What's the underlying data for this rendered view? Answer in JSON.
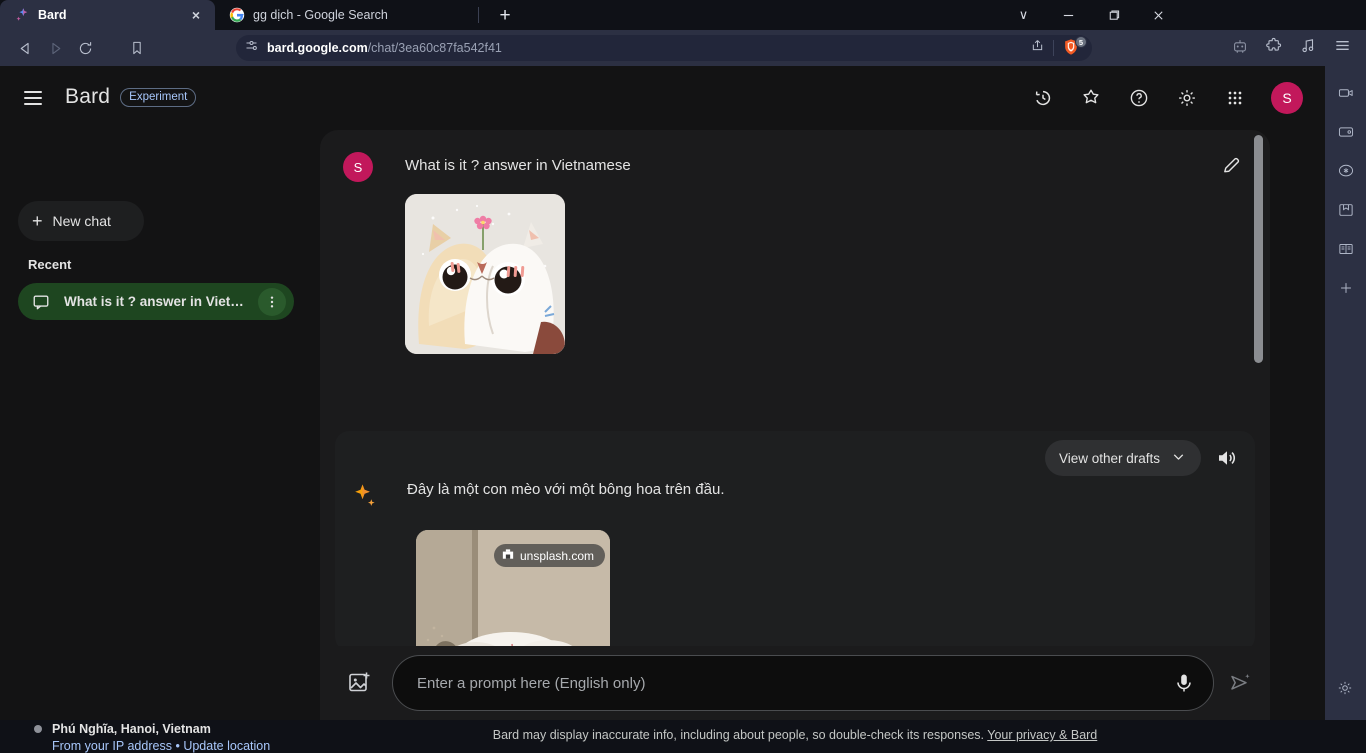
{
  "browser": {
    "name": "Brave",
    "tabs": [
      {
        "title": "Bard",
        "favicon": "bard-sparkle-icon",
        "active": true,
        "close_label": "×"
      },
      {
        "title": "gg dịch - Google Search",
        "favicon": "google-g-icon",
        "active": false
      }
    ],
    "newtab_label": "+",
    "window_controls": {
      "chevron": "∨",
      "minimize": "—",
      "maximize": "❐",
      "close": "✕"
    },
    "omnibox": {
      "url_bold": "bard.google.com",
      "url_rest": "/chat/3ea60c87fa542f41",
      "permissions_icon": "site-settings-icon",
      "share_icon": "share-icon",
      "shield_icon": "brave-shields-lion-icon",
      "shield_badge_count": "5"
    },
    "toolbar_icons": [
      "brave-leo-robot-icon",
      "extensions-puzzle-icon",
      "brave-playlist-music-icon",
      "browser-menu-icon"
    ],
    "side_panel_icons": [
      "brave-talk-video-icon",
      "brave-wallet-icon",
      "leo-ai-chat-icon",
      "bookmarks-icon",
      "reading-list-icon",
      "add-panel-icon"
    ],
    "side_panel_bottom_icon": "settings-gear-icon"
  },
  "app": {
    "header": {
      "menu_icon": "hamburger-menu-icon",
      "brand": "Bard",
      "badge": "Experiment",
      "icons": [
        "history-clock-icon",
        "extensions-star-icon",
        "help-question-icon",
        "settings-gear-icon",
        "google-apps-grid-icon"
      ],
      "avatar_initial": "S"
    },
    "sidebar": {
      "new_chat_label": "New chat",
      "new_chat_icon": "plus-icon",
      "recent_label": "Recent",
      "chats": [
        {
          "label": "What is it ? answer in Viet…",
          "icon": "chat-bubble-icon",
          "more_icon": "more-vertical-icon",
          "active": true
        }
      ],
      "location": {
        "place": "Phú Nghĩa, Hanoi, Vietnam",
        "source": "From your IP address",
        "separator": "•",
        "update_link": "Update location"
      }
    },
    "conversation": {
      "user_turn": {
        "avatar_initial": "S",
        "text": "What is it ? answer in Vietnamese",
        "edit_icon": "edit-pencil-icon",
        "attached_image_alt": "cat-with-flower-illustration"
      },
      "model_turn": {
        "sparkle_icon": "bard-sparkle-icon",
        "drafts_label": "View other drafts",
        "drafts_chevron_icon": "chevron-down-icon",
        "speaker_icon": "speaker-volume-icon",
        "text": "Đây là một con mèo với một bông hoa trên đầu.",
        "image_source_badge": "unsplash.com",
        "image_source_icon": "unsplash-camera-icon",
        "result_image_alt": "white-flower-photo"
      }
    },
    "composer": {
      "upload_icon": "add-image-icon",
      "placeholder": "Enter a prompt here (English only)",
      "mic_icon": "microphone-icon",
      "send_icon": "send-sparkle-icon"
    },
    "disclaimer": {
      "text": "Bard may display inaccurate info, including about people, so double-check its responses.",
      "link": "Your privacy & Bard"
    }
  },
  "colors": {
    "app_bg": "#131314",
    "conversation_bg": "#1b1b1c",
    "card_bg": "#1e1f20",
    "active_chat_bg": "#1e4620",
    "accent_blue": "#a8c7fa",
    "avatar_pink": "#c2185b",
    "browser_chrome": "#2c3043"
  }
}
